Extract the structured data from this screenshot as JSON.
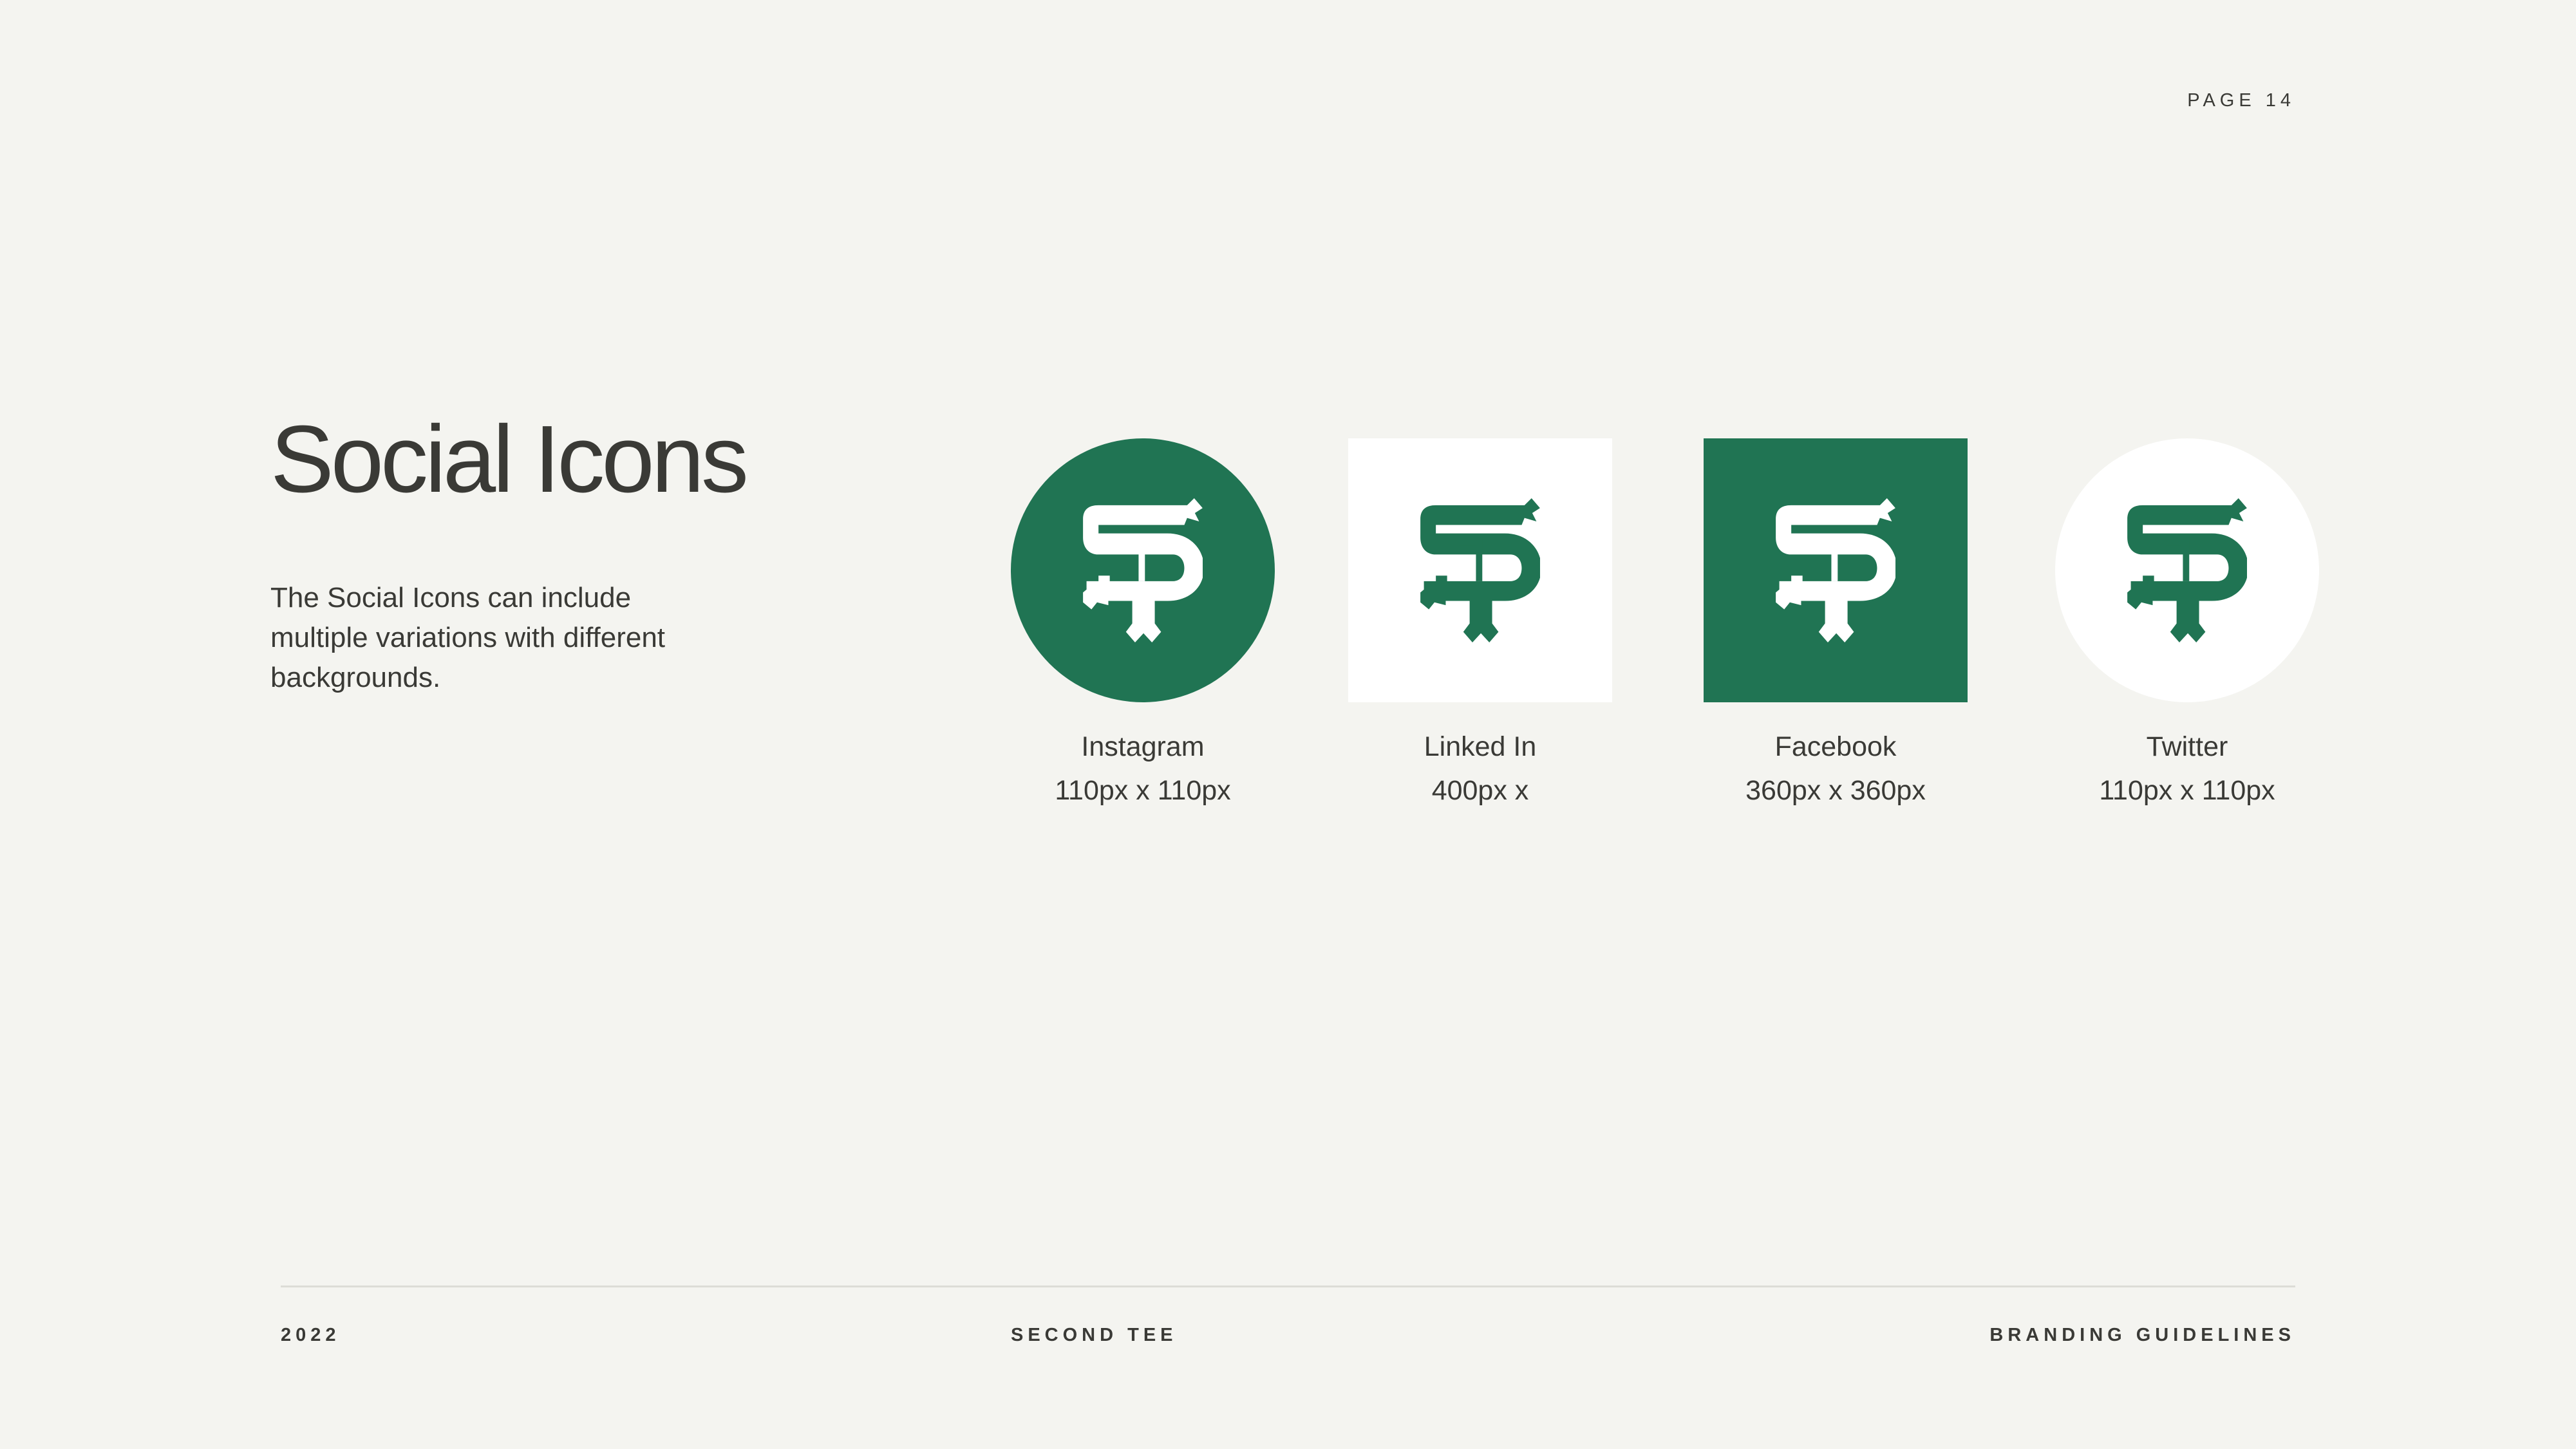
{
  "header": {
    "page_label": "PAGE 14"
  },
  "main": {
    "title": "Social Icons",
    "description": "The Social Icons can include multiple variations with different backgrounds."
  },
  "icons": [
    {
      "name": "Instagram",
      "size": "110px x 110px",
      "shape": "circle",
      "background": "#207453",
      "logo_color": "#ffffff"
    },
    {
      "name": "Linked In",
      "size": "400px x",
      "shape": "square",
      "background": "#ffffff",
      "logo_color": "#207453"
    },
    {
      "name": "Facebook",
      "size": "360px x 360px",
      "shape": "square",
      "background": "#207453",
      "logo_color": "#ffffff"
    },
    {
      "name": "Twitter",
      "size": "110px x 110px",
      "shape": "circle",
      "background": "#ffffff",
      "logo_color": "#207453"
    }
  ],
  "footer": {
    "year": "2022",
    "brand": "SECOND TEE",
    "document": "BRANDING GUIDELINES"
  },
  "colors": {
    "brand_green": "#207453",
    "background": "#f4f4f0",
    "text": "#3a3a36"
  }
}
